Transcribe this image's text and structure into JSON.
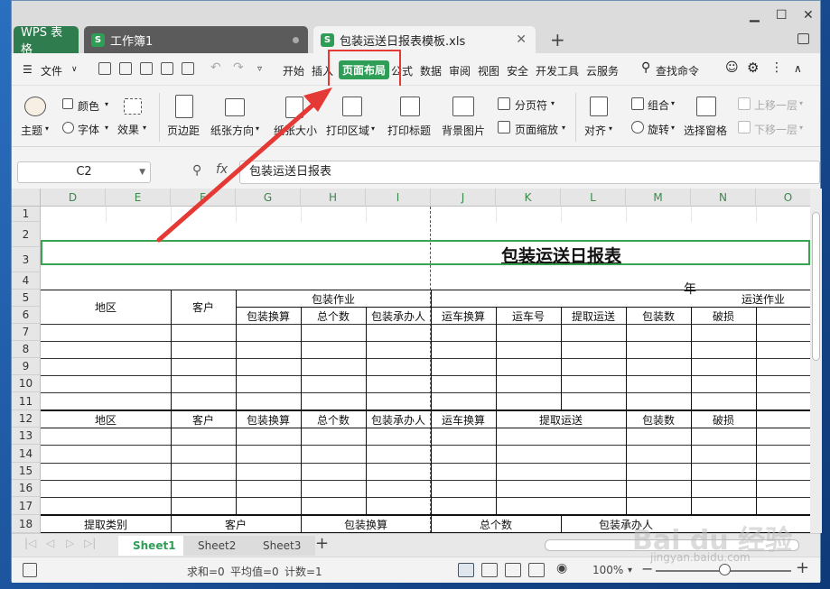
{
  "titlebar": {
    "tab_wps": "WPS 表格",
    "tab_workbook": "工作簿1",
    "tab_file": "包装运送日报表模板.xls",
    "sheet_icon": "S"
  },
  "menu": {
    "file": "文件",
    "items": [
      "开始",
      "插入",
      "页面布局",
      "公式",
      "数据",
      "审阅",
      "视图",
      "安全",
      "开发工具",
      "云服务"
    ],
    "search": "查找命令"
  },
  "ribbon": {
    "theme": "主题",
    "color": "颜色",
    "font": "字体",
    "effect": "效果",
    "margin": "页边距",
    "orientation": "纸张方向",
    "size": "纸张大小",
    "print_area": "打印区域",
    "print_title": "打印标题",
    "background": "背景图片",
    "page_break": "分页符",
    "page_zoom": "页面缩放",
    "align": "对齐",
    "group": "组合",
    "rotate": "旋转",
    "selection_pane": "选择窗格",
    "bring_forward": "上移一层",
    "send_backward": "下移一层"
  },
  "formula": {
    "cell_ref": "C2",
    "fx": "fx",
    "content": "包装运送日报表"
  },
  "columns": [
    "D",
    "E",
    "F",
    "G",
    "H",
    "I",
    "J",
    "K",
    "L",
    "M",
    "N",
    "O"
  ],
  "rows": [
    "1",
    "2",
    "3",
    "4",
    "5",
    "6",
    "7",
    "8",
    "9",
    "10",
    "11",
    "12",
    "13",
    "14",
    "15",
    "16",
    "17",
    "18"
  ],
  "sheet": {
    "title": "包装运送日报表",
    "year": "年",
    "region": "地区",
    "customer": "客户",
    "pack_op": "包装作业",
    "transport_op": "运送作业",
    "pack_calc": "包装换算",
    "total": "总个数",
    "pack_person": "包装承办人",
    "truck_calc": "运车换算",
    "truck_no": "运车号",
    "pickup": "提取运送",
    "pack_count": "包装数",
    "damage": "破损",
    "pickup_type": "提取类别"
  },
  "sheet_tabs": [
    "Sheet1",
    "Sheet2",
    "Sheet3"
  ],
  "status": {
    "sum": "求和=0",
    "avg": "平均值=0",
    "count": "计数=1",
    "zoom": "100%"
  },
  "watermark": {
    "main": "Bai du 经验",
    "sub": "jingyan.baidu.com"
  },
  "colors": {
    "accent": "#2e9e57",
    "highlight": "#e53935"
  }
}
